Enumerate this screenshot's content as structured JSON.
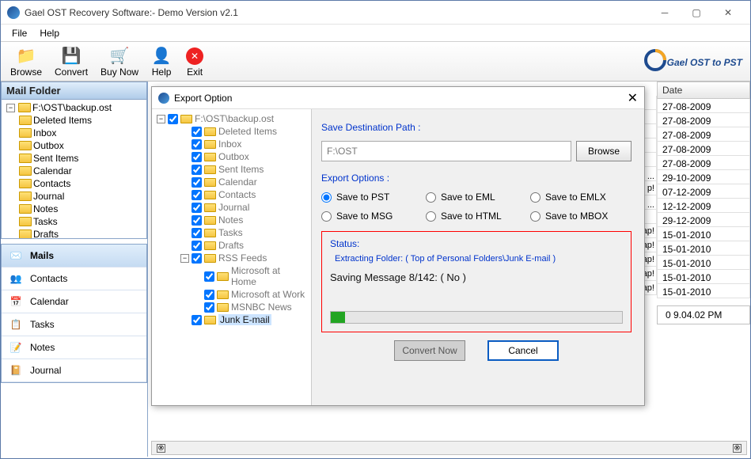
{
  "window": {
    "title": "Gael OST Recovery Software:- Demo Version v2.1"
  },
  "menu": {
    "file": "File",
    "help": "Help"
  },
  "toolbar": {
    "browse": "Browse",
    "convert": "Convert",
    "buynow": "Buy Now",
    "help": "Help",
    "exit": "Exit"
  },
  "brand": {
    "part1": "ael",
    "part2": " OST to PST"
  },
  "mailfolder": {
    "title": "Mail Folder",
    "root": "F:\\OST\\backup.ost",
    "items": [
      "Deleted Items",
      "Inbox",
      "Outbox",
      "Sent Items",
      "Calendar",
      "Contacts",
      "Journal",
      "Notes",
      "Tasks",
      "Drafts"
    ]
  },
  "nav": {
    "mails": "Mails",
    "contacts": "Contacts",
    "calendar": "Calendar",
    "tasks": "Tasks",
    "notes": "Notes",
    "journal": "Journal"
  },
  "grid": {
    "date_header": "Date",
    "rows": [
      {
        "ext": "",
        "date": "27-08-2009"
      },
      {
        "ext": "",
        "date": "27-08-2009"
      },
      {
        "ext": "",
        "date": "27-08-2009"
      },
      {
        "ext": "",
        "date": "27-08-2009"
      },
      {
        "ext": "",
        "date": "27-08-2009"
      },
      {
        "ext": "ツ left ...",
        "date": "29-10-2009"
      },
      {
        "ext": "p!",
        "date": "07-12-2009"
      },
      {
        "ext": "ツ left ...",
        "date": "12-12-2009"
      },
      {
        "ext": "",
        "date": "29-12-2009"
      },
      {
        "ext": "w scrap!",
        "date": "15-01-2010"
      },
      {
        "ext": "w scrap!",
        "date": "15-01-2010"
      },
      {
        "ext": "w scrap!",
        "date": "15-01-2010"
      },
      {
        "ext": "w scrap!",
        "date": "15-01-2010"
      },
      {
        "ext": "w scrap!",
        "date": "15-01-2010"
      }
    ],
    "time": "0 9.04.02 PM"
  },
  "dialog": {
    "title": "Export Option",
    "save_dest_label": "Save Destination Path :",
    "path_value": "F:\\OST",
    "browse": "Browse",
    "export_opts_label": "Export Options :",
    "opts": {
      "pst": "Save to PST",
      "eml": "Save to EML",
      "emlx": "Save to EMLX",
      "msg": "Save to MSG",
      "html": "Save to HTML",
      "mbox": "Save to MBOX"
    },
    "status_label": "Status:",
    "status_line": "Extracting Folder: ( Top of Personal Folders\\Junk E-mail )",
    "saving_line": "Saving Message 8/142: ( No )",
    "convert": "Convert Now",
    "cancel": "Cancel",
    "tree": {
      "root": "F:\\OST\\backup.ost",
      "items": [
        "Deleted Items",
        "Inbox",
        "Outbox",
        "Sent Items",
        "Calendar",
        "Contacts",
        "Journal",
        "Notes",
        "Tasks",
        "Drafts"
      ],
      "rss": "RSS Feeds",
      "rss_items": [
        "Microsoft at Home",
        "Microsoft at Work",
        "MSNBC News"
      ],
      "junk": "Junk E-mail"
    }
  }
}
